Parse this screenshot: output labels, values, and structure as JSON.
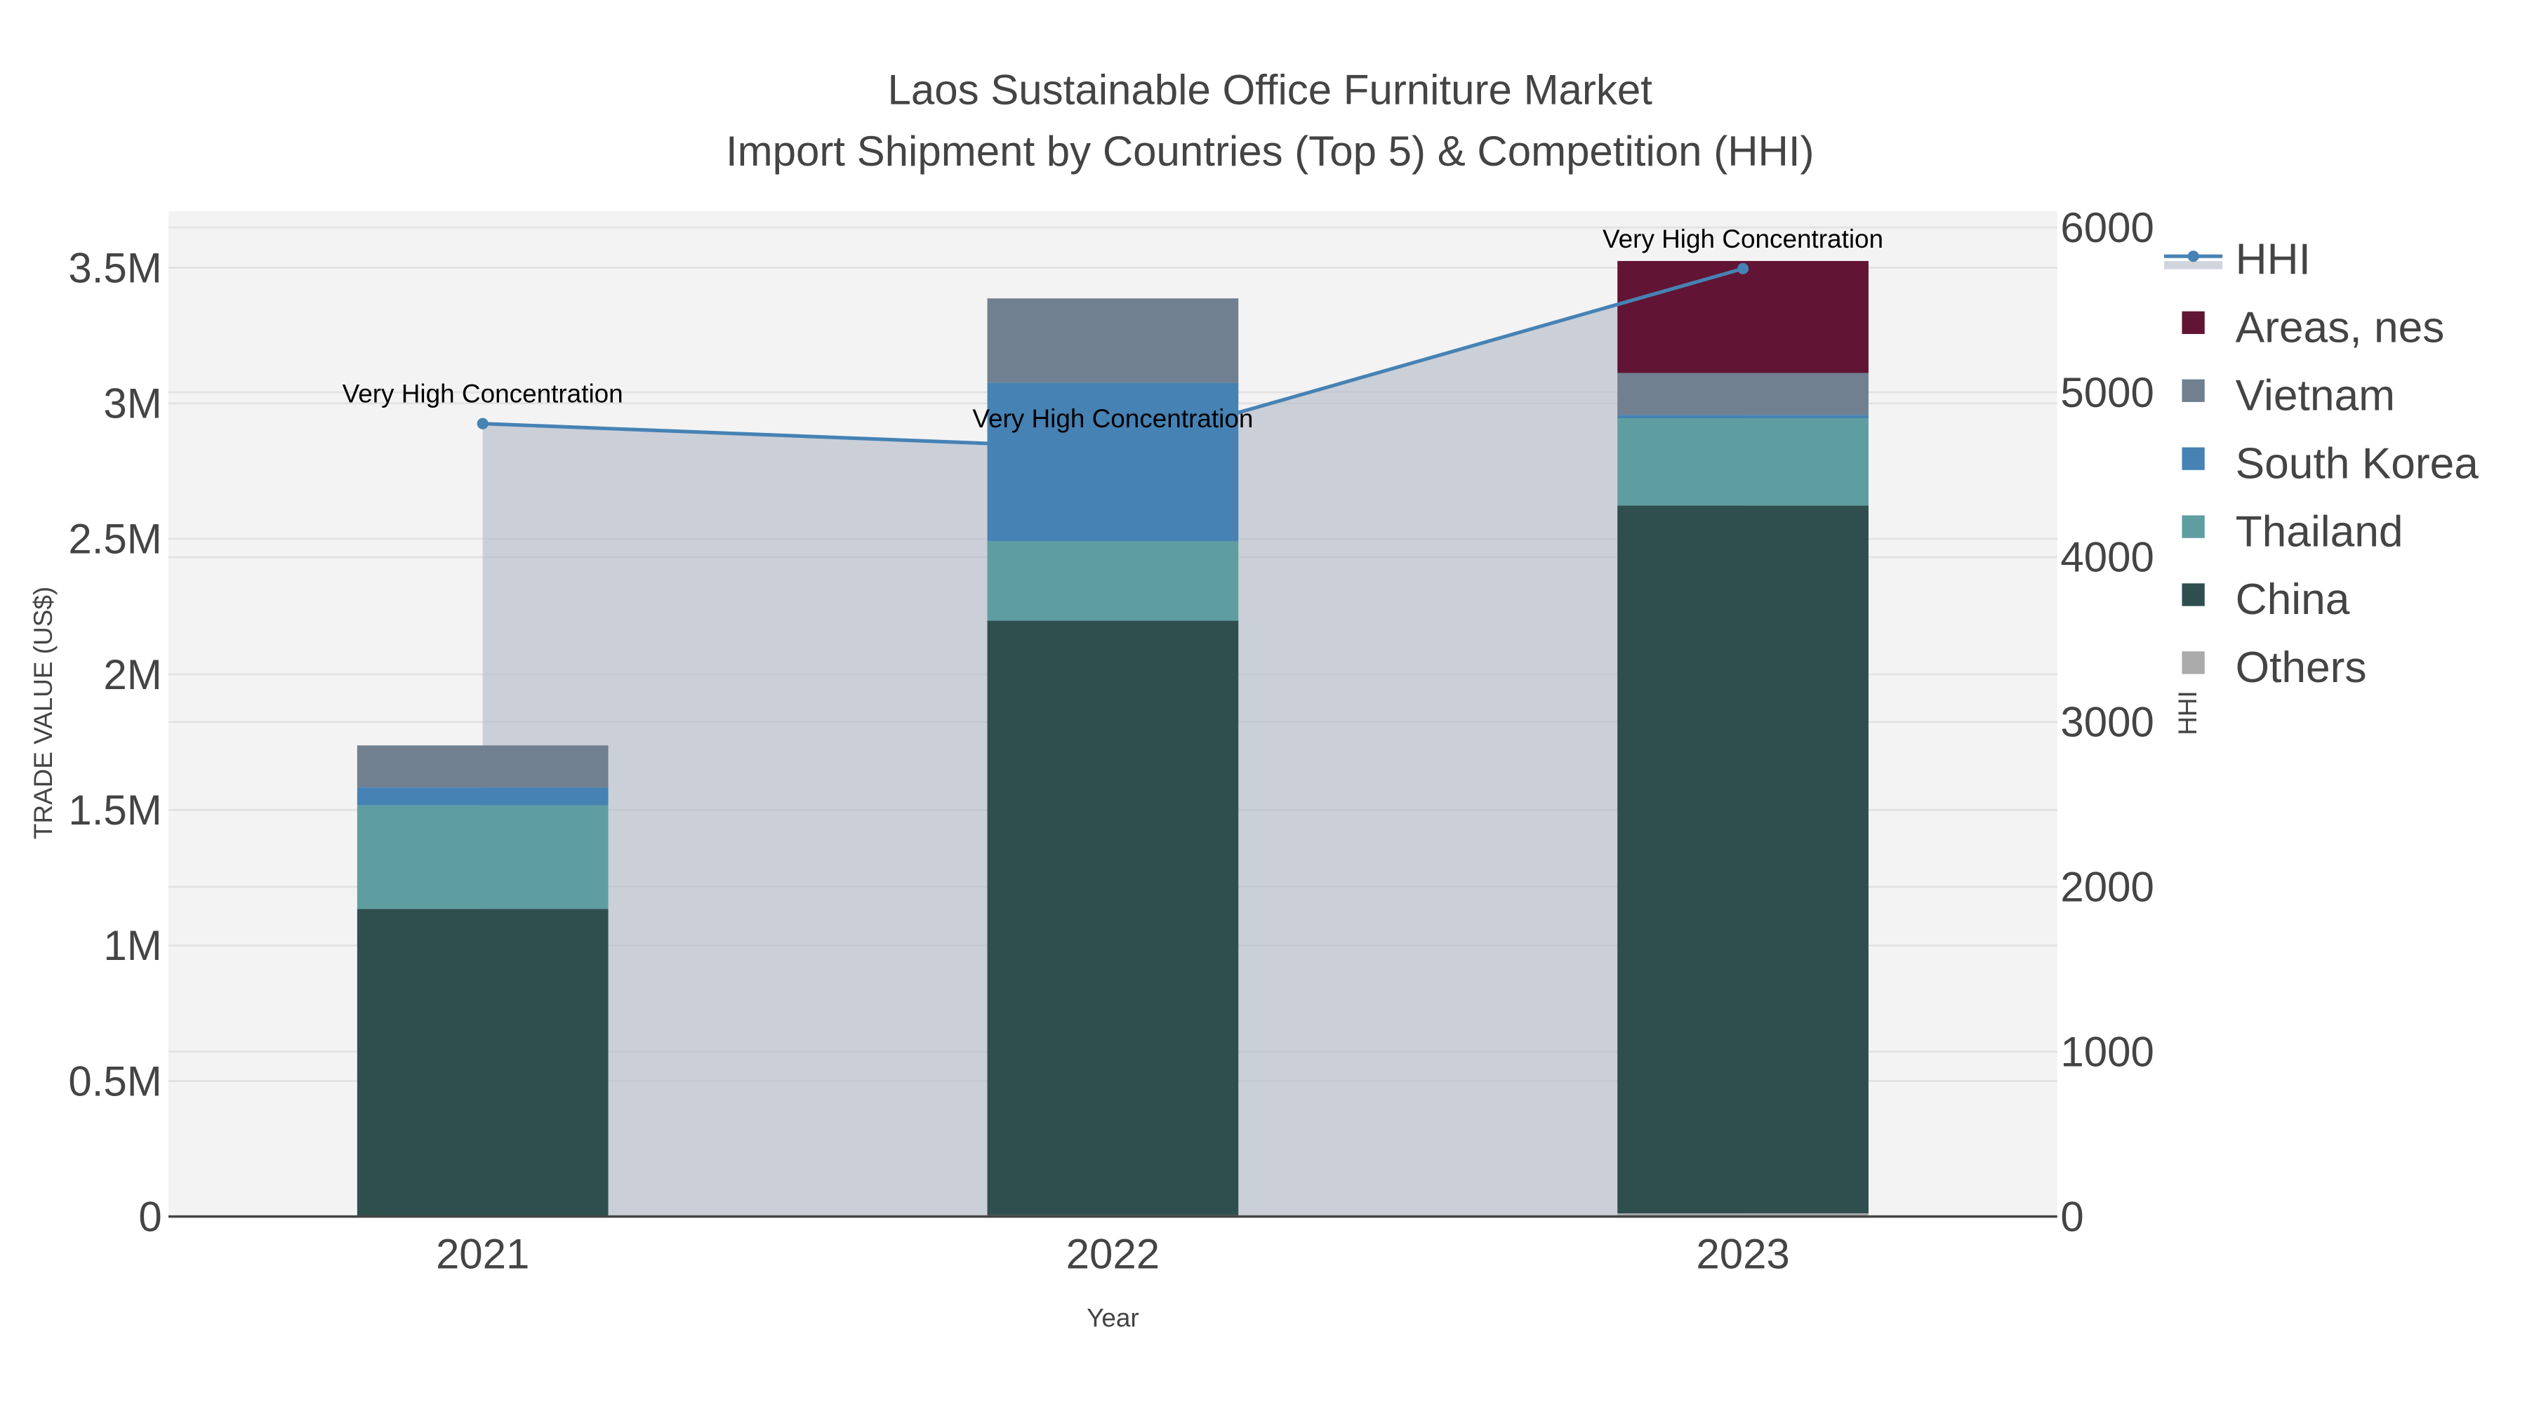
{
  "chart_data": {
    "type": "bar",
    "title": "Laos Sustainable Office Furniture Market",
    "subtitle": "Import Shipment by Countries (Top 5) & Competition (HHI)",
    "xlabel": "Year",
    "ylabel": "TRADE VALUE (US$)",
    "y2label": "HHI",
    "categories": [
      "2021",
      "2022",
      "2023"
    ],
    "ylim": [
      0,
      3.7
    ],
    "yticks": [
      {
        "v": 0,
        "label": "0"
      },
      {
        "v": 0.5,
        "label": "0.5M"
      },
      {
        "v": 1,
        "label": "1M"
      },
      {
        "v": 1.5,
        "label": "1.5M"
      },
      {
        "v": 2,
        "label": "2M"
      },
      {
        "v": 2.5,
        "label": "2.5M"
      },
      {
        "v": 3,
        "label": "3M"
      },
      {
        "v": 3.5,
        "label": "3.5M"
      }
    ],
    "y2lim": [
      0,
      6100
    ],
    "y2ticks": [
      "0",
      "1000",
      "2000",
      "3000",
      "4000",
      "5000",
      "6000"
    ],
    "stack_order": [
      "Others",
      "China",
      "Thailand",
      "South Korea",
      "Vietnam",
      "Areas, nes"
    ],
    "series": [
      {
        "name": "Others",
        "color": "#aaaaaa",
        "values": [
          0.0,
          0.005,
          0.012
        ]
      },
      {
        "name": "China",
        "color": "#2f4f4f",
        "values": [
          1.135,
          2.193,
          2.611
        ]
      },
      {
        "name": "Thailand",
        "color": "#5f9ea0",
        "values": [
          0.382,
          0.293,
          0.322
        ]
      },
      {
        "name": "South Korea",
        "color": "#4682b4",
        "values": [
          0.066,
          0.585,
          0.012
        ]
      },
      {
        "name": "Vietnam",
        "color": "#708090",
        "values": [
          0.155,
          0.311,
          0.155
        ]
      },
      {
        "name": "Areas, nes",
        "color": "#611434",
        "values": [
          0.0,
          0.0,
          0.413
        ]
      }
    ],
    "hhi": {
      "name": "HHI",
      "color": "#4682b4",
      "values": [
        4810,
        4660,
        5750
      ],
      "annotations": [
        "Very High Concentration",
        "Very High Concentration",
        "Very High Concentration"
      ]
    },
    "legend": [
      "HHI",
      "Areas, nes",
      "Vietnam",
      "South Korea",
      "Thailand",
      "China",
      "Others"
    ],
    "legend_position": "right",
    "grid": true
  }
}
